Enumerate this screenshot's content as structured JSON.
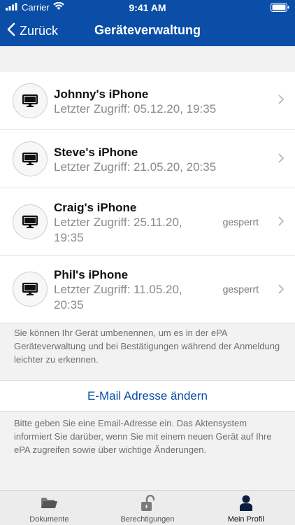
{
  "status_bar": {
    "carrier": "Carrier",
    "time": "9:41 AM"
  },
  "nav": {
    "back_label": "Zurück",
    "title": "Geräteverwaltung"
  },
  "devices": [
    {
      "name": "Johnny's iPhone",
      "access": "Letzter Zugriff: 05.12.20, 19:35",
      "status": ""
    },
    {
      "name": "Steve's iPhone",
      "access": "Letzter Zugriff: 21.05.20, 20:35",
      "status": ""
    },
    {
      "name": "Craig's iPhone",
      "access_line1": "Letzter Zugriff: 25.11.20,",
      "access_line2": "19:35",
      "status": "gesperrt"
    },
    {
      "name": "Phil's iPhone",
      "access_line1": "Letzter Zugriff: 11.05.20,",
      "access_line2": "20:35",
      "status": "gesperrt"
    }
  ],
  "rename_info": "Sie können Ihr Gerät umbenennen, um es in der ePA Geräteverwaltung und bei Bestätigungen während der Anmeldung leichter zu erkennen.",
  "email": {
    "link_label": "E-Mail Adresse ändern",
    "info": "Bitte geben Sie eine Email-Adresse ein. Das Aktensystem informiert Sie darüber, wenn Sie mit einem neuen Gerät auf Ihre ePA zugreifen sowie über wichtige Änderungen."
  },
  "tabs": [
    {
      "label": "Dokumente",
      "icon": "folder-icon"
    },
    {
      "label": "Berechtigungen",
      "icon": "lock-icon"
    },
    {
      "label": "Mein Profil",
      "icon": "person-icon",
      "active": true
    }
  ],
  "colors": {
    "brand": "#0a4ea7",
    "background": "#f2f2f2"
  }
}
